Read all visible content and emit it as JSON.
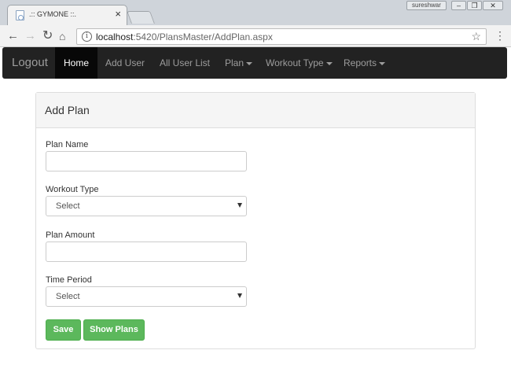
{
  "browser": {
    "tab_title": ".:: GYMONE ::.",
    "tab_close": "×",
    "user_badge": "sureshwar",
    "win_min": "–",
    "win_max": "❐",
    "win_close": "✕",
    "url_host": "localhost",
    "url_path": ":5420/PlansMaster/AddPlan.aspx",
    "icons": {
      "back": "←",
      "forward": "→",
      "reload": "↻",
      "home": "⌂",
      "info": "i",
      "star": "☆",
      "menu": "⋮"
    }
  },
  "navbar": {
    "brand": "Logout",
    "links": [
      {
        "label": "Home",
        "active": true
      },
      {
        "label": "Add User"
      },
      {
        "label": "All User List"
      },
      {
        "label": "Plan"
      },
      {
        "label": "Workout Type"
      },
      {
        "label": "Reports"
      }
    ]
  },
  "panel": {
    "title": "Add Plan",
    "plan_name_label": "Plan Name",
    "plan_name_value": "",
    "workout_type_label": "Workout Type",
    "workout_type_selected": "Select",
    "plan_amount_label": "Plan Amount",
    "plan_amount_value": "",
    "time_period_label": "Time Period",
    "time_period_selected": "Select",
    "save_label": "Save",
    "show_plans_label": "Show Plans"
  },
  "colors": {
    "navbar_bg": "#222222",
    "button_green": "#5cb85c"
  }
}
